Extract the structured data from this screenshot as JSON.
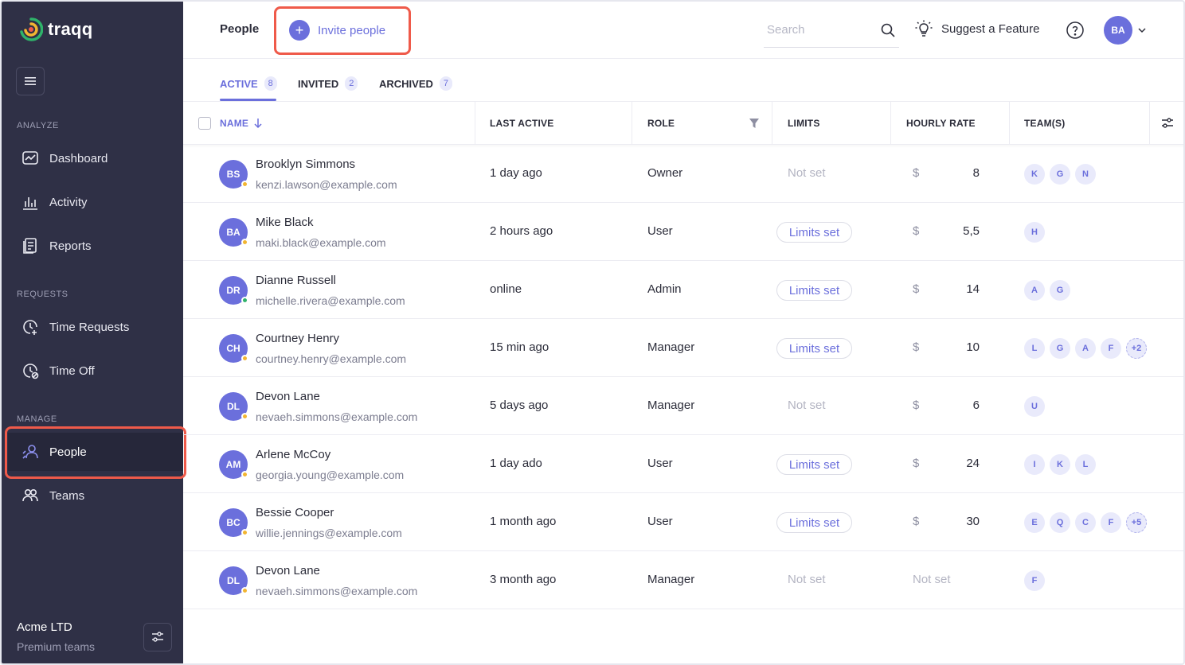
{
  "app": {
    "name": "traqq"
  },
  "sidebar": {
    "sections": {
      "analyze": "ANALYZE",
      "requests": "REQUESTS",
      "manage": "MANAGE"
    },
    "items": [
      {
        "label": "Dashboard",
        "icon": "dashboard-icon"
      },
      {
        "label": "Activity",
        "icon": "activity-icon"
      },
      {
        "label": "Reports",
        "icon": "reports-icon"
      },
      {
        "label": "Time Requests",
        "icon": "time-request-icon"
      },
      {
        "label": "Time Off",
        "icon": "time-off-icon"
      },
      {
        "label": "People",
        "icon": "people-icon",
        "active": true
      },
      {
        "label": "Teams",
        "icon": "teams-icon"
      }
    ],
    "company": {
      "name": "Acme LTD",
      "plan": "Premium teams"
    }
  },
  "header": {
    "title": "People",
    "invite_label": "Invite people",
    "search_placeholder": "Search",
    "suggest_label": "Suggest a Feature",
    "user_initials": "BA"
  },
  "tabs": [
    {
      "label": "ACTIVE",
      "count": "8",
      "active": true
    },
    {
      "label": "INVITED",
      "count": "2"
    },
    {
      "label": "ARCHIVED",
      "count": "7"
    }
  ],
  "table": {
    "columns": {
      "name": "NAME",
      "last_active": "LAST ACTIVE",
      "role": "ROLE",
      "limits": "LIMITS",
      "hourly_rate": "HOURLY RATE",
      "teams": "TEAM(S)"
    },
    "currency": "$",
    "rows": [
      {
        "initials": "BS",
        "name": "Brooklyn Simmons",
        "email": "kenzi.lawson@example.com",
        "status": "away",
        "last_active": "1 day ago",
        "role": "Owner",
        "limits": "Not set",
        "limits_set": false,
        "rate": "8",
        "rate_set": true,
        "teams": [
          "K",
          "G",
          "N"
        ]
      },
      {
        "initials": "BA",
        "name": "Mike Black",
        "email": "maki.black@example.com",
        "status": "away",
        "last_active": "2 hours ago",
        "role": "User",
        "limits": "Limits set",
        "limits_set": true,
        "rate": "5,5",
        "rate_set": true,
        "teams": [
          "H"
        ]
      },
      {
        "initials": "DR",
        "name": "Dianne Russell",
        "email": "michelle.rivera@example.com",
        "status": "online",
        "last_active": "online",
        "role": "Admin",
        "limits": "Limits set",
        "limits_set": true,
        "rate": "14",
        "rate_set": true,
        "teams": [
          "A",
          "G"
        ]
      },
      {
        "initials": "CH",
        "name": "Courtney Henry",
        "email": "courtney.henry@example.com",
        "status": "away",
        "last_active": "15 min ago",
        "role": "Manager",
        "limits": "Limits set",
        "limits_set": true,
        "rate": "10",
        "rate_set": true,
        "teams": [
          "L",
          "G",
          "A",
          "F",
          "+2"
        ]
      },
      {
        "initials": "DL",
        "name": "Devon Lane",
        "email": "nevaeh.simmons@example.com",
        "status": "away",
        "last_active": "5 days ago",
        "role": "Manager",
        "limits": "Not set",
        "limits_set": false,
        "rate": "6",
        "rate_set": true,
        "teams": [
          "U"
        ]
      },
      {
        "initials": "AM",
        "name": "Arlene McCoy",
        "email": "georgia.young@example.com",
        "status": "away",
        "last_active": "1 day ado",
        "role": "User",
        "limits": "Limits set",
        "limits_set": true,
        "rate": "24",
        "rate_set": true,
        "teams": [
          "I",
          "K",
          "L"
        ]
      },
      {
        "initials": "BC",
        "name": "Bessie Cooper",
        "email": "willie.jennings@example.com",
        "status": "away",
        "last_active": "1 month ago",
        "role": "User",
        "limits": "Limits set",
        "limits_set": true,
        "rate": "30",
        "rate_set": true,
        "teams": [
          "E",
          "Q",
          "C",
          "F",
          "+5"
        ]
      },
      {
        "initials": "DL",
        "name": "Devon Lane",
        "email": "nevaeh.simmons@example.com",
        "status": "away",
        "last_active": "3 month ago",
        "role": "Manager",
        "limits": "Not set",
        "limits_set": false,
        "rate": "Not set",
        "rate_set": false,
        "teams": [
          "F"
        ]
      }
    ]
  },
  "colors": {
    "accent": "#6b6fdc",
    "sidebar": "#2f3046",
    "highlight": "#ef5a4a",
    "online": "#2fb36a",
    "away": "#f2b531"
  }
}
